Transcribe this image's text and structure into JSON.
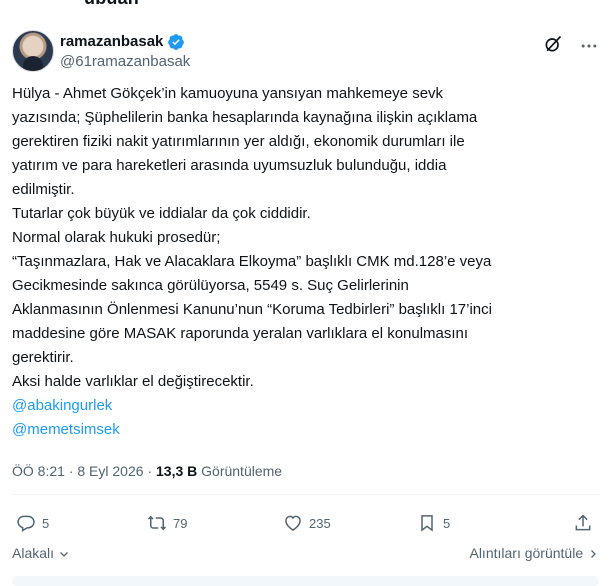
{
  "top_cut_text": "ubuan",
  "author": {
    "display_name": "ramazanbasak",
    "handle": "@61ramazanbasak"
  },
  "body_lines": [
    "Hülya - Ahmet Gökçek’in kamuoyuna yansıyan mahkemeye sevk",
    "yazısında; Şüphelilerin banka hesaplarında kaynağına ilişkin açıklama",
    "gerektiren fiziki nakit yatırımlarının yer aldığı, ekonomik durumları ile",
    "yatırım ve para hareketleri arasında uyumsuzluk bulunduğu, iddia",
    "edilmiştir.",
    "Tutarlar çok büyük ve iddialar da çok ciddidir.",
    "Normal olarak hukuki prosedür;",
    "“Taşınmazlara, Hak ve Alacaklara Elkoyma” başlıklı CMK md.128’e veya",
    "Gecikmesinde sakınca görülüyorsa, 5549 s. Suç Gelirlerinin",
    "Aklanmasının Önlenmesi Kanunu’nun “Koruma Tedbirleri” başlıklı 17’inci",
    "maddesine göre MASAK raporunda yeralan varlıklara el konulmasını",
    "gerektirir.",
    "Aksi halde varlıklar el değiştirecektir."
  ],
  "mentions": [
    "@abakingurlek",
    "@memetsimsek"
  ],
  "meta": {
    "time": "ÖÖ 8:21",
    "separator": "·",
    "date": "8 Eyl 2026",
    "views_count": "13,3 B",
    "views_label": "Görüntüleme"
  },
  "actions": {
    "replies": "5",
    "reposts": "79",
    "likes": "235",
    "bookmarks": "5"
  },
  "footer": {
    "related": "Alakalı",
    "quotes": "Alıntıları görüntüle"
  },
  "colors": {
    "accent": "#1d9bf0",
    "text": "#0f1419",
    "muted": "#536471"
  },
  "icons": [
    "verified-badge-icon",
    "grok-icon",
    "more-icon",
    "reply-icon",
    "repost-icon",
    "like-icon",
    "bookmark-icon",
    "share-icon",
    "chevron-down-icon",
    "chevron-right-icon"
  ]
}
